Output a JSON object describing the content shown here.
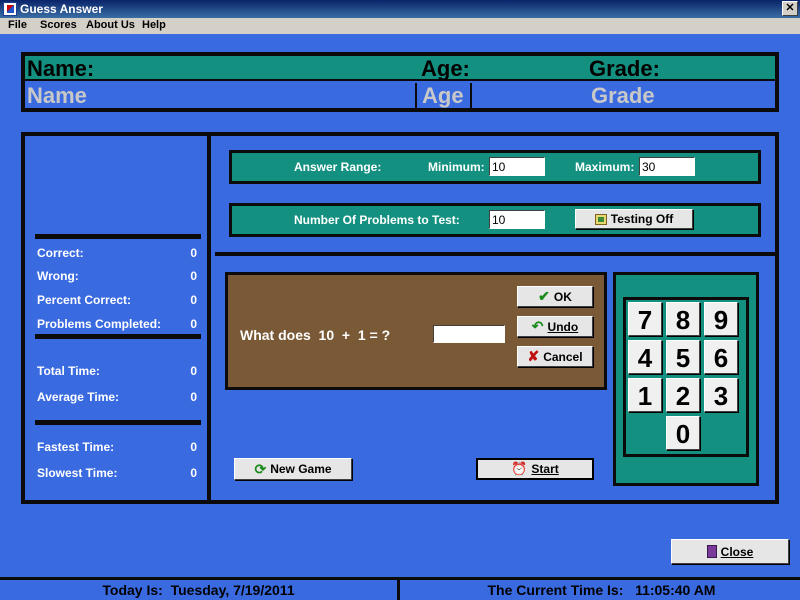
{
  "window": {
    "title": "Guess Answer",
    "close_glyph": "✕"
  },
  "menu": [
    "File",
    "Scores",
    "About Us",
    "Help"
  ],
  "student": {
    "name_label": "Name:",
    "age_label": "Age:",
    "grade_label": "Grade:",
    "name_value": "Name",
    "age_value": "Age",
    "grade_value": "Grade"
  },
  "stats": {
    "correct_label": "Correct:",
    "correct": "0",
    "wrong_label": "Wrong:",
    "wrong": "0",
    "percent_label": "Percent Correct:",
    "percent": "0",
    "completed_label": "Problems Completed:",
    "completed": "0",
    "total_time_label": "Total Time:",
    "total_time": "0",
    "avg_time_label": "Average Time:",
    "avg_time": "0",
    "fastest_label": "Fastest Time:",
    "fastest": "0",
    "slowest_label": "Slowest Time:",
    "slowest": "0"
  },
  "range": {
    "label": "Answer Range:",
    "min_label": "Minimum:",
    "min": "10",
    "max_label": "Maximum:",
    "max": "30"
  },
  "problems": {
    "label": "Number Of Problems to Test:",
    "count": "10",
    "testing_button": "Testing Off"
  },
  "question": {
    "text": "What does  10  +  1 = ?",
    "answer": ""
  },
  "buttons": {
    "ok": "OK",
    "undo": "Undo",
    "cancel": "Cancel",
    "new_game": "New Game",
    "start": "Start",
    "close": "Close"
  },
  "keypad": [
    "7",
    "8",
    "9",
    "4",
    "5",
    "6",
    "1",
    "2",
    "3",
    "0"
  ],
  "status": {
    "date_label": "Today Is:",
    "date": "Tuesday, 7/19/2011",
    "time_label": "The Current Time Is:",
    "time": "11:05:40 AM"
  },
  "colors": {
    "background": "#3a6ae0",
    "teal": "#149080",
    "question_box": "#7a5a36"
  },
  "icons": [
    "app-icon",
    "close-icon",
    "checkmark-icon",
    "undo-icon",
    "cancel-x-icon",
    "refresh-icon",
    "alarm-clock-icon",
    "exit-door-icon",
    "testing-icon"
  ]
}
